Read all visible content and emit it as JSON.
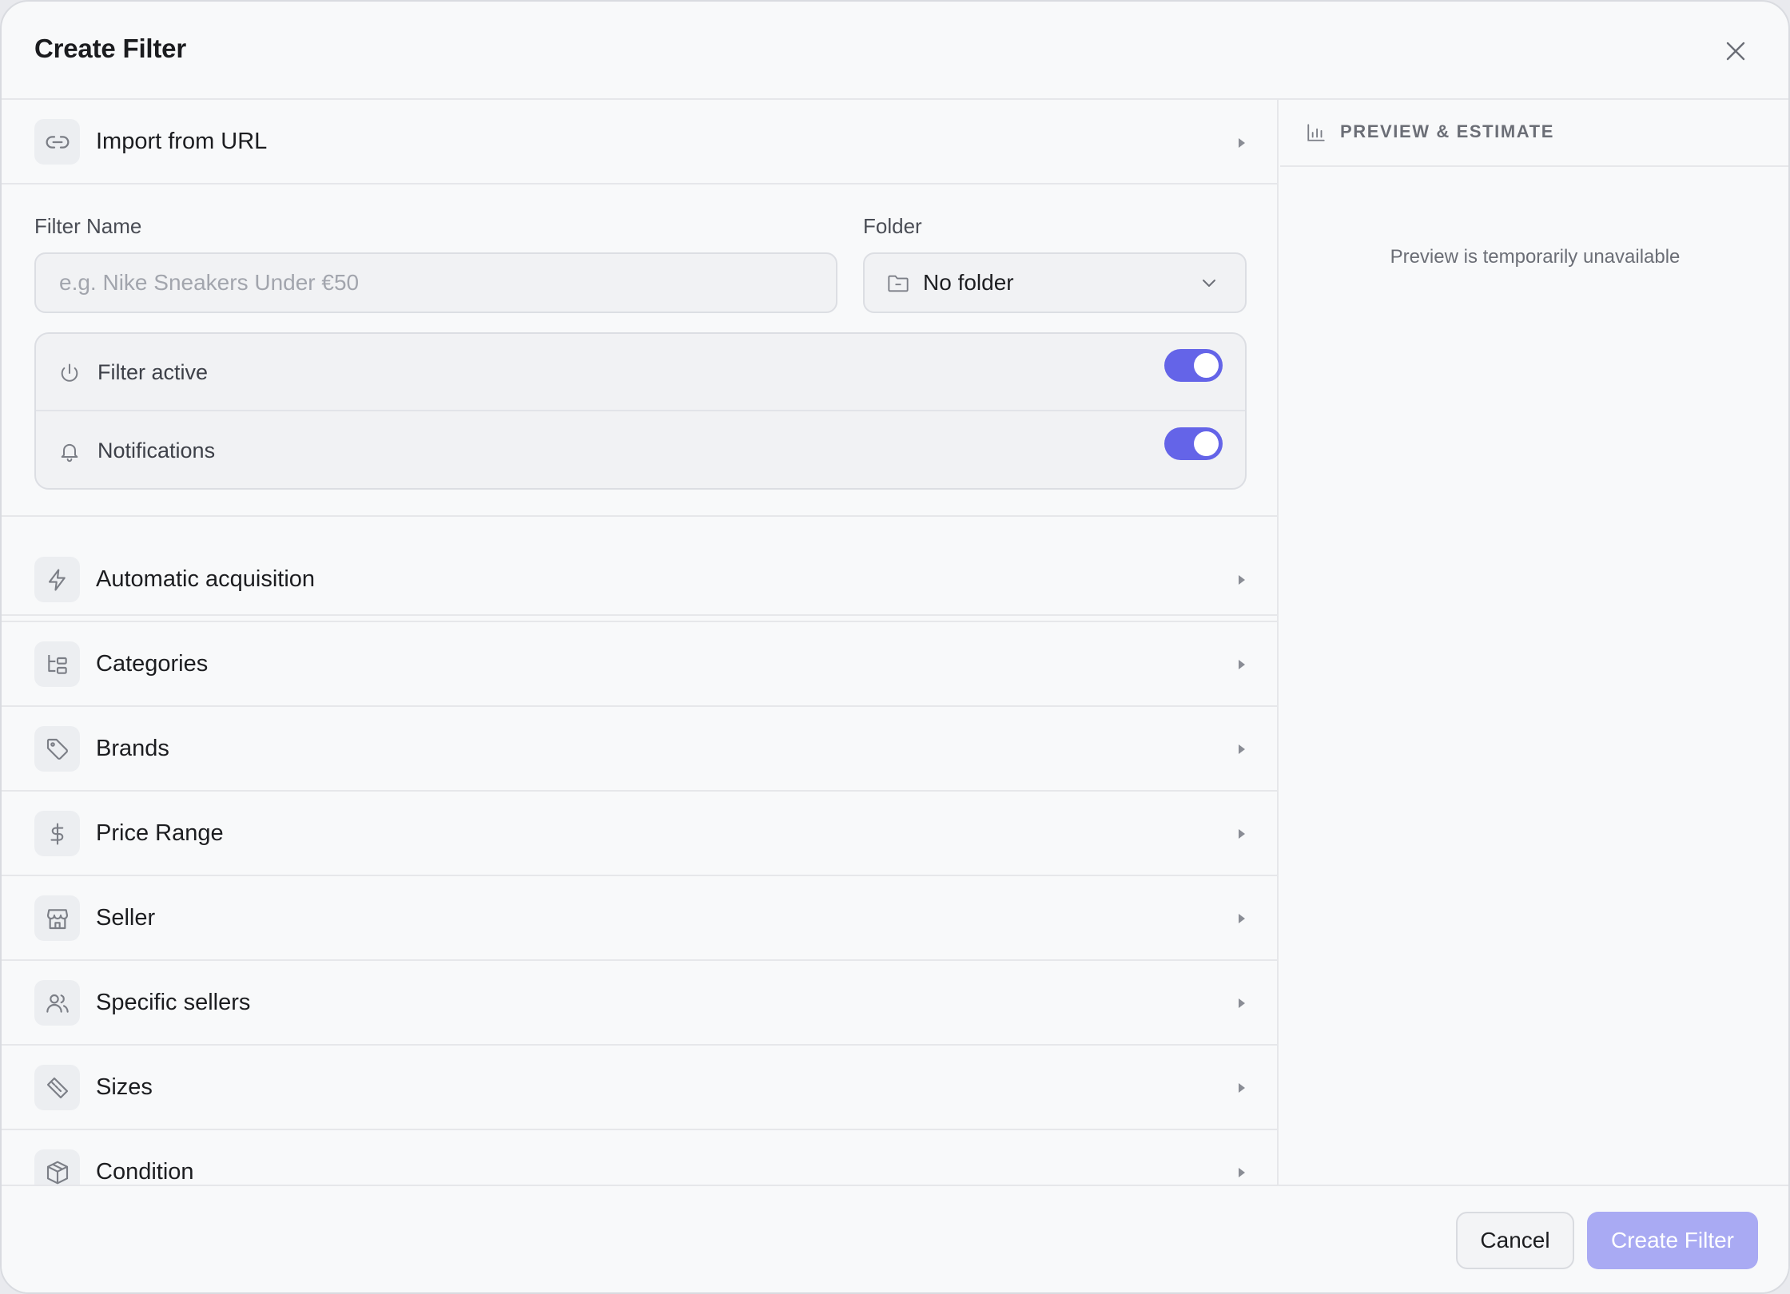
{
  "dialog": {
    "title": "Create Filter"
  },
  "import_row": {
    "label": "Import from URL",
    "icon": "link-icon"
  },
  "form": {
    "name_label": "Filter Name",
    "name_placeholder": "e.g. Nike Sneakers Under €50",
    "name_value": "",
    "folder_label": "Folder",
    "folder_value": "No folder"
  },
  "toggles": [
    {
      "label": "Filter active",
      "icon": "power-icon",
      "on": true
    },
    {
      "label": "Notifications",
      "icon": "bell-icon",
      "on": true
    }
  ],
  "sections": [
    {
      "label": "Automatic acquisition",
      "icon": "lightning-icon"
    },
    {
      "label": "Categories",
      "icon": "category-tree-icon"
    },
    {
      "label": "Brands",
      "icon": "tag-icon"
    },
    {
      "label": "Price Range",
      "icon": "dollar-icon"
    },
    {
      "label": "Seller",
      "icon": "store-icon"
    },
    {
      "label": "Specific sellers",
      "icon": "users-icon"
    },
    {
      "label": "Sizes",
      "icon": "ruler-icon"
    },
    {
      "label": "Condition",
      "icon": "box-icon"
    }
  ],
  "preview": {
    "title": "PREVIEW & ESTIMATE",
    "message": "Preview is temporarily unavailable",
    "icon": "bar-chart-icon"
  },
  "footer": {
    "cancel_label": "Cancel",
    "create_label": "Create Filter"
  },
  "colors": {
    "accent": "#6464e8",
    "create_disabled": "#a9aaf3",
    "background": "#f8f9fa"
  }
}
